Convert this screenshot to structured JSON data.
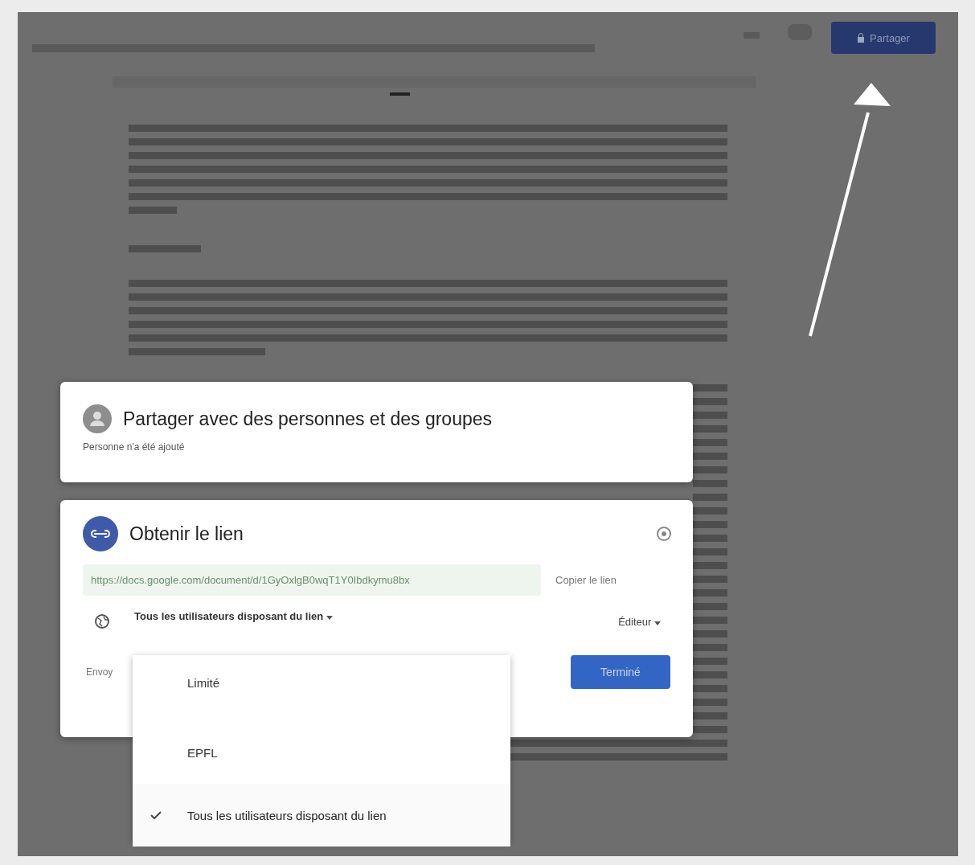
{
  "share_button": {
    "label": "Partager"
  },
  "people_panel": {
    "title": "Partager avec des personnes et des groupes",
    "subtitle": "Personne n'a été ajouté"
  },
  "link_panel": {
    "title": "Obtenir le lien",
    "url": "https://docs.google.com/document/d/1GyOxlgB0wqT1Y0Ibdkymu8bx",
    "copy_label": "Copier le lien",
    "access": "Tous les utilisateurs disposant du lien",
    "role": "Éditeur",
    "feedback": "Envoy",
    "done": "Terminé"
  },
  "access_menu": [
    {
      "label": "Limité",
      "selected": false
    },
    {
      "label": "EPFL",
      "selected": false
    },
    {
      "label": "Tous les utilisateurs disposant du lien",
      "selected": true
    }
  ]
}
